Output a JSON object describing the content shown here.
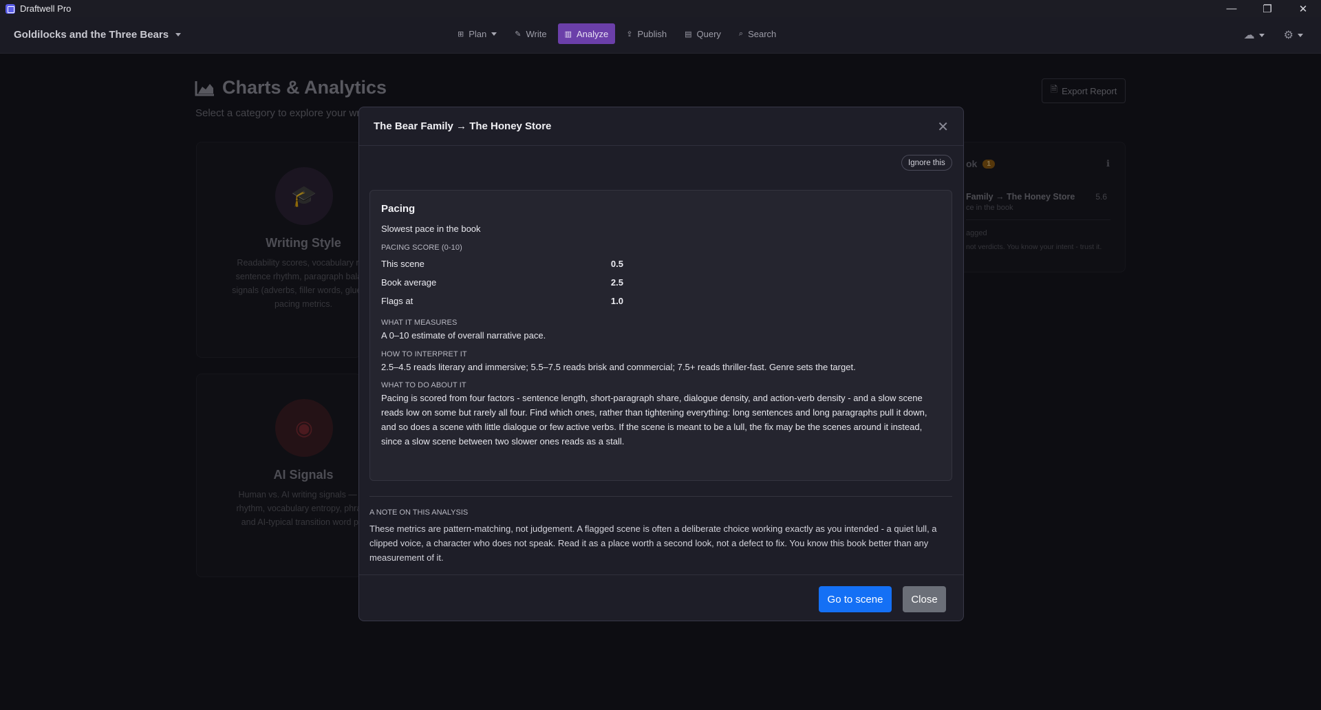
{
  "window": {
    "title": "Draftwell Pro",
    "controls": {
      "minimize": "—",
      "restore": "❐",
      "close": "✕"
    }
  },
  "nav": {
    "project": "Goldilocks and the Three Bears",
    "items": [
      {
        "label": "Plan",
        "icon": "sitemap-icon",
        "active": false
      },
      {
        "label": "Write",
        "icon": "pencil-icon",
        "active": false
      },
      {
        "label": "Analyze",
        "icon": "bar-chart-icon",
        "active": true
      },
      {
        "label": "Publish",
        "icon": "upload-icon",
        "active": false
      },
      {
        "label": "Query",
        "icon": "table-icon",
        "active": false
      },
      {
        "label": "Search",
        "icon": "search-icon",
        "active": false
      }
    ]
  },
  "page": {
    "title": "Charts & Analytics",
    "subtitle": "Select a category to explore your writ",
    "export_label": "Export Report"
  },
  "cards": [
    {
      "title": "Writing Style",
      "icon": "graduation-cap-icon",
      "lines": [
        "Readability scores, vocabulary rich",
        "sentence rhythm, paragraph balanc",
        "signals (adverbs, filler words, glue wo",
        "pacing metrics."
      ]
    },
    {
      "title": "AI Signals",
      "icon": "eye-icon",
      "lines": [
        "Human vs. AI writing signals — se",
        "rhythm, vocabulary entropy, phrase",
        "and AI-typical transition word pat"
      ]
    }
  ],
  "right_panel": {
    "heading_fragment": "ok",
    "badge": "1",
    "item_title": "Family → The Honey Store",
    "item_score": "5.6",
    "item_sub": "ce in the book",
    "flagged_text": "agged",
    "footer_text": "not verdicts. You know your intent - trust it."
  },
  "modal": {
    "title": "The Bear Family → The Honey Store",
    "ignore_label": "Ignore this",
    "metric": {
      "name": "Pacing",
      "headline": "Slowest pace in the book",
      "score_label": "PACING SCORE (0-10)",
      "rows": [
        {
          "label": "This scene",
          "value": "0.5"
        },
        {
          "label": "Book average",
          "value": "2.5"
        },
        {
          "label": "Flags at",
          "value": "1.0"
        }
      ],
      "measures_label": "WHAT IT MEASURES",
      "measures_text": "A 0–10 estimate of overall narrative pace.",
      "interpret_label": "HOW TO INTERPRET IT",
      "interpret_text": "2.5–4.5 reads literary and immersive; 5.5–7.5 reads brisk and commercial; 7.5+ reads thriller-fast. Genre sets the target.",
      "todo_label": "WHAT TO DO ABOUT IT",
      "todo_text": "Pacing is scored from four factors - sentence length, short-paragraph share, dialogue density, and action-verb density - and a slow scene reads low on some but rarely all four. Find which ones, rather than tightening everything: long sentences and long paragraphs pull it down, and so does a scene with little dialogue or few active verbs. If the scene is meant to be a lull, the fix may be the scenes around it instead, since a slow scene between two slower ones reads as a stall."
    },
    "note_label": "A NOTE ON THIS ANALYSIS",
    "note_text": "These metrics are pattern-matching, not judgement. A flagged scene is often a deliberate choice working exactly as you intended - a quiet lull, a clipped voice, a character who does not speak. Read it as a place worth a second look, not a defect to fix. You know this book better than any measurement of it.",
    "primary_label": "Go to scene",
    "secondary_label": "Close"
  }
}
